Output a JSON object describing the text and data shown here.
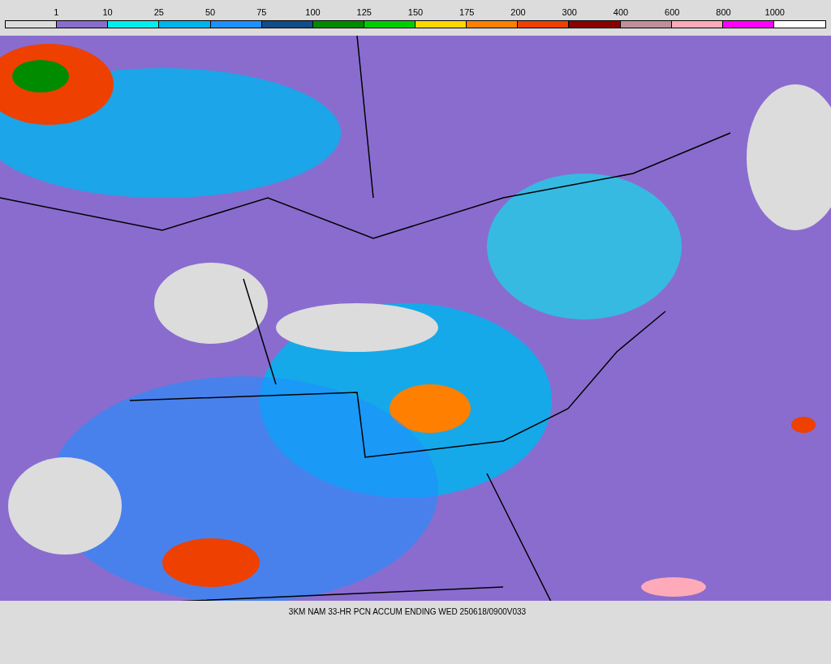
{
  "legend": {
    "labels": [
      "1",
      "10",
      "25",
      "50",
      "75",
      "100",
      "125",
      "150",
      "175",
      "200",
      "300",
      "400",
      "600",
      "800",
      "1000"
    ],
    "bins": [
      {
        "color": "#dcdcdc"
      },
      {
        "color": "#8a6ccf"
      },
      {
        "color": "#00eeee"
      },
      {
        "color": "#00b4ee"
      },
      {
        "color": "#1e90ff"
      },
      {
        "color": "#104e8b"
      },
      {
        "color": "#008b00"
      },
      {
        "color": "#00cd00"
      },
      {
        "color": "#ffd700"
      },
      {
        "color": "#ff7f00"
      },
      {
        "color": "#ee4000"
      },
      {
        "color": "#8b0000"
      },
      {
        "color": "#c0909a"
      },
      {
        "color": "#ffaab8"
      },
      {
        "color": "#ff00ff"
      },
      {
        "color": "#ffffff"
      }
    ]
  },
  "caption": "3KM NAM 33-HR PCN ACCUM ENDING WED 250618/0900V033"
}
